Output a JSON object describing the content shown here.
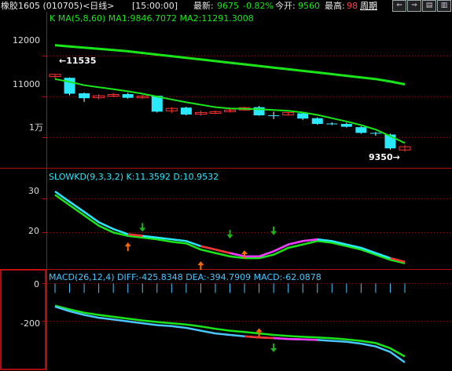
{
  "header": {
    "title": "橡胶1605 (010705)<日线>",
    "time": "[15:00:00]",
    "latest_label": "最新:",
    "latest_value": "9675",
    "change_pct": "-0.82%",
    "open_label": "今开:",
    "open_value": "9560",
    "high_label": "最高:",
    "high_value": "98",
    "period_button": "周期"
  },
  "colors": {
    "ma_green": "#19e619",
    "kd_cyan": "#29e8ff",
    "macd_cyan": "#48c6ff",
    "red": "#ff3030",
    "magenta": "#ff33ff",
    "arrow_up": "#ff6a00",
    "arrow_down": "#1eb41e",
    "label_red": "#ff4040"
  },
  "price_panel": {
    "indicator_text": "K  MA(5,8,60) MA1:9846.7072 MA2:11291.3008",
    "y_labels": [
      "12000",
      "11000",
      "1万"
    ],
    "high_marker": "←11535",
    "low_marker": "9350→"
  },
  "kd_panel": {
    "indicator_text": "SLOWKD(9,3,3,2) K:11.3592 D:10.9532",
    "y_labels": [
      "30",
      "20"
    ]
  },
  "macd_panel": {
    "indicator_text": "MACD(26,12,4) DIFF:-425.8348 DEA:-394.7909 MACD:-62.0878",
    "y_labels": [
      "0",
      "-200"
    ]
  },
  "chart_data": {
    "type": "line",
    "candles": [
      {
        "open": 11480,
        "close": 11535,
        "high": 11535,
        "low": 11430
      },
      {
        "open": 11450,
        "close": 11060,
        "high": 11460,
        "low": 11020
      },
      {
        "open": 11070,
        "close": 10950,
        "high": 11090,
        "low": 10860
      },
      {
        "open": 10960,
        "close": 11010,
        "high": 11050,
        "low": 10920
      },
      {
        "open": 11000,
        "close": 11040,
        "high": 11080,
        "low": 10980
      },
      {
        "open": 11050,
        "close": 10960,
        "high": 11080,
        "low": 10940
      },
      {
        "open": 10960,
        "close": 11000,
        "high": 11030,
        "low": 10940
      },
      {
        "open": 11010,
        "close": 10620,
        "high": 11010,
        "low": 10600
      },
      {
        "open": 10640,
        "close": 10700,
        "high": 10730,
        "low": 10580
      },
      {
        "open": 10720,
        "close": 10550,
        "high": 10740,
        "low": 10530
      },
      {
        "open": 10560,
        "close": 10600,
        "high": 10650,
        "low": 10520
      },
      {
        "open": 10580,
        "close": 10620,
        "high": 10650,
        "low": 10560
      },
      {
        "open": 10620,
        "close": 10660,
        "high": 10700,
        "low": 10600
      },
      {
        "open": 10660,
        "close": 10720,
        "high": 10740,
        "low": 10640
      },
      {
        "open": 10730,
        "close": 10530,
        "high": 10760,
        "low": 10520
      },
      {
        "open": 10530,
        "close": 10520,
        "high": 10620,
        "low": 10440
      },
      {
        "open": 10540,
        "close": 10600,
        "high": 10610,
        "low": 10520
      },
      {
        "open": 10580,
        "close": 10450,
        "high": 10600,
        "low": 10420
      },
      {
        "open": 10460,
        "close": 10320,
        "high": 10480,
        "low": 10300
      },
      {
        "open": 10330,
        "close": 10310,
        "high": 10360,
        "low": 10290
      },
      {
        "open": 10320,
        "close": 10250,
        "high": 10350,
        "low": 10230
      },
      {
        "open": 10240,
        "close": 10100,
        "high": 10260,
        "low": 10080
      },
      {
        "open": 10100,
        "close": 10080,
        "high": 10120,
        "low": 10030
      },
      {
        "open": 10060,
        "close": 9720,
        "high": 10080,
        "low": 9690
      },
      {
        "open": 9680,
        "close": 9760,
        "high": 9800,
        "low": 9640
      }
    ],
    "ma1": [
      11420,
      11350,
      11270,
      11220,
      11170,
      11120,
      11060,
      10990,
      10920,
      10850,
      10790,
      10730,
      10700,
      10690,
      10680,
      10660,
      10640,
      10600,
      10540,
      10460,
      10380,
      10290,
      10180,
      10020,
      9850
    ],
    "ma2": [
      12250,
      12220,
      12190,
      12160,
      12130,
      12100,
      12060,
      12020,
      11980,
      11940,
      11900,
      11860,
      11820,
      11780,
      11740,
      11700,
      11660,
      11620,
      11580,
      11540,
      11500,
      11460,
      11420,
      11360,
      11290
    ],
    "ylim_price": [
      9300,
      12800
    ],
    "kd_k": [
      32,
      29,
      26,
      23,
      21,
      19.5,
      19,
      18.5,
      18,
      17.5,
      16,
      15,
      14,
      13,
      13,
      14.5,
      16.5,
      17.5,
      18,
      17.5,
      16.5,
      15.5,
      14,
      12.5,
      11.4
    ],
    "kd_d": [
      31,
      28,
      25,
      22,
      20,
      19,
      18.5,
      18,
      17.3,
      16.8,
      15,
      14,
      13,
      12.5,
      12.5,
      13.5,
      15.5,
      16.5,
      17.5,
      17,
      16,
      15,
      13.5,
      12,
      11
    ],
    "ylim_kd": [
      10,
      35
    ],
    "macd_diff": [
      -125,
      -150,
      -170,
      -185,
      -195,
      -205,
      -215,
      -225,
      -230,
      -240,
      -255,
      -270,
      -278,
      -285,
      -292,
      -295,
      -300,
      -302,
      -305,
      -310,
      -315,
      -325,
      -340,
      -370,
      -426
    ],
    "macd_dea": [
      -120,
      -140,
      -158,
      -170,
      -180,
      -190,
      -200,
      -208,
      -215,
      -222,
      -232,
      -245,
      -255,
      -262,
      -270,
      -278,
      -284,
      -288,
      -292,
      -296,
      -302,
      -310,
      -322,
      -350,
      -395
    ],
    "ylim_macd": [
      -460,
      10
    ]
  }
}
